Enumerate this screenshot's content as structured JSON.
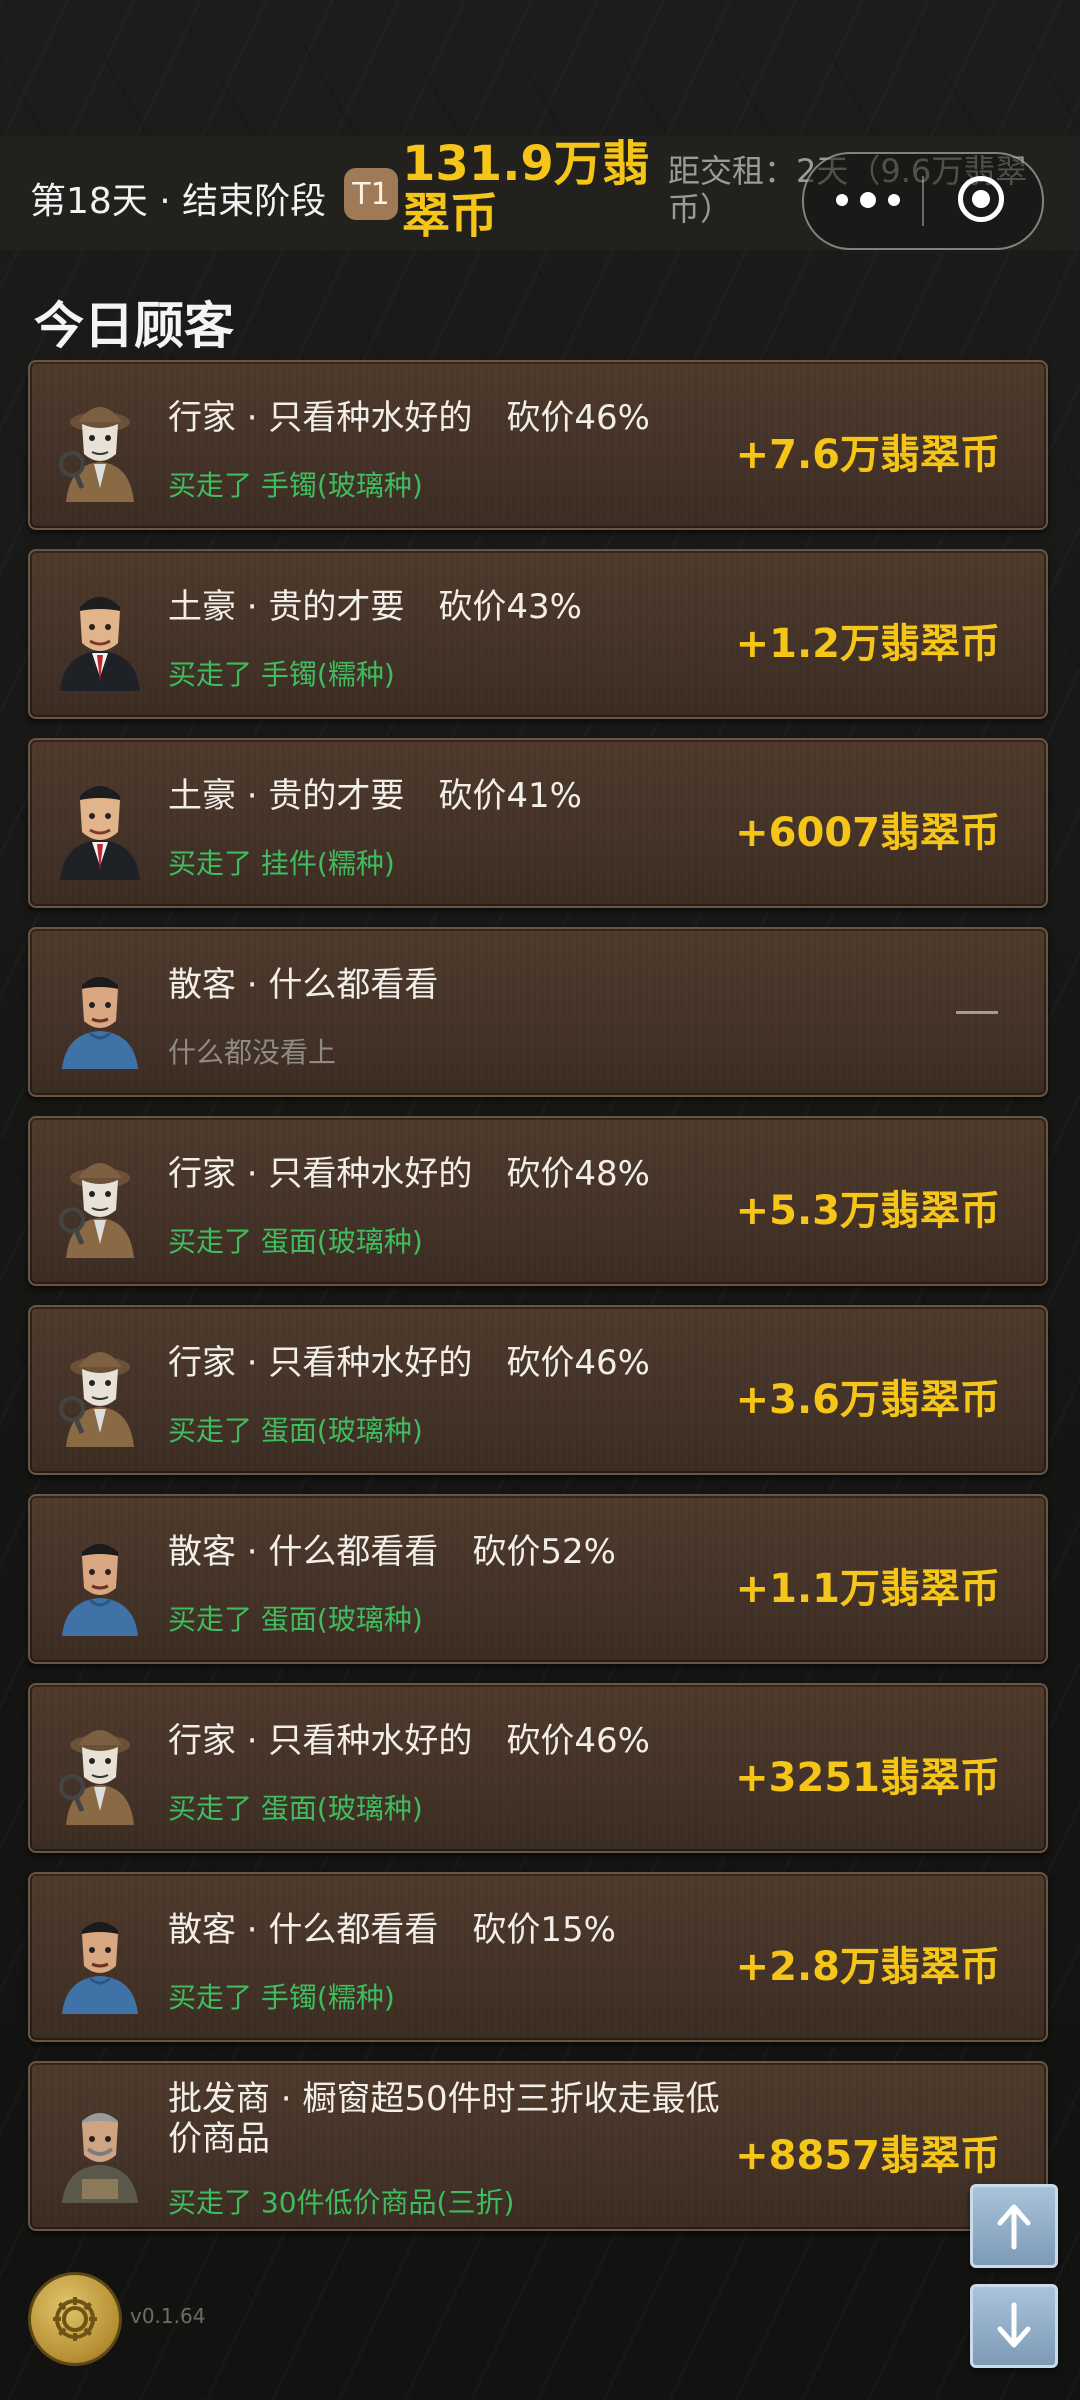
{
  "header": {
    "day_text": "第18天 · 结束阶段",
    "tier_badge": "T1",
    "coins_total": "131.9万翡翠币",
    "rent_text": "距交租：2天（9.6万翡翠币）",
    "capsule_icons": [
      "more-icon",
      "close-target-icon"
    ]
  },
  "section_title": "今日顾客",
  "customers": [
    {
      "avatar": "connoisseur",
      "title": "行家 · 只看种水好的　砍价46%",
      "subtitle": "买走了 手镯(玻璃种)",
      "amount": "+7.6万翡翠币"
    },
    {
      "avatar": "tycoon",
      "title": "土豪 · 贵的才要　砍价43%",
      "subtitle": "买走了 手镯(糯种)",
      "amount": "+1.2万翡翠币"
    },
    {
      "avatar": "tycoon",
      "title": "土豪 · 贵的才要　砍价41%",
      "subtitle": "买走了 挂件(糯种)",
      "amount": "+6007翡翠币"
    },
    {
      "avatar": "casual",
      "title": "散客 · 什么都看看",
      "subtitle": "什么都没看上",
      "amount": ""
    },
    {
      "avatar": "connoisseur",
      "title": "行家 · 只看种水好的　砍价48%",
      "subtitle": "买走了 蛋面(玻璃种)",
      "amount": "+5.3万翡翠币"
    },
    {
      "avatar": "connoisseur",
      "title": "行家 · 只看种水好的　砍价46%",
      "subtitle": "买走了 蛋面(玻璃种)",
      "amount": "+3.6万翡翠币"
    },
    {
      "avatar": "casual",
      "title": "散客 · 什么都看看　砍价52%",
      "subtitle": "买走了 蛋面(玻璃种)",
      "amount": "+1.1万翡翠币"
    },
    {
      "avatar": "connoisseur",
      "title": "行家 · 只看种水好的　砍价46%",
      "subtitle": "买走了 蛋面(玻璃种)",
      "amount": "+3251翡翠币"
    },
    {
      "avatar": "casual",
      "title": "散客 · 什么都看看　砍价15%",
      "subtitle": "买走了 手镯(糯种)",
      "amount": "+2.8万翡翠币"
    },
    {
      "avatar": "wholesaler",
      "title": "批发商 · 橱窗超50件时三折收走最低价商品",
      "subtitle": "买走了 30件低价商品(三折)",
      "amount": "+8857翡翠币"
    }
  ],
  "footer": {
    "version": "v0.1.64",
    "settings_icon": "gear-icon",
    "scroll_up_icon": "arrow-up-icon",
    "scroll_down_icon": "arrow-down-icon"
  },
  "colors": {
    "accent_gold": "#f5c518",
    "success_green": "#3fbd5e",
    "card_brown": "#4a372b",
    "muted_gray": "#8f8a84"
  }
}
